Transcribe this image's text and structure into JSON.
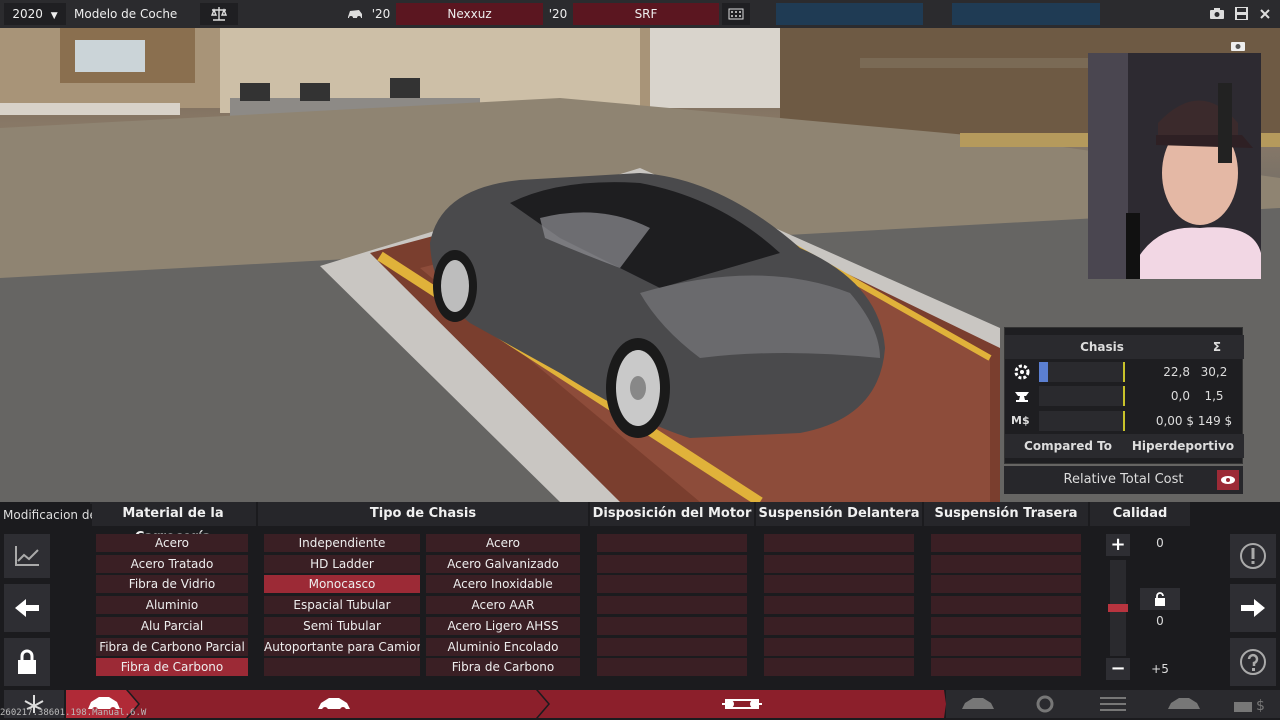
{
  "topbar": {
    "year": "2020",
    "model_label": "Modelo de Coche year",
    "model_year_prefix": "'20",
    "model_name": "Nexxuz",
    "trim_year_prefix": "'20",
    "trim_name": "SRF"
  },
  "stats": {
    "header_label": "Chasis",
    "sum_label": "Σ",
    "rows": [
      {
        "icon": "gear-wrench-icon",
        "value": "22,8",
        "total": "30,2",
        "bar": 0.1
      },
      {
        "icon": "anvil-icon",
        "value": "0,0",
        "total": "1,5",
        "bar": 0
      },
      {
        "icon": "money-icon",
        "icon_text": "M$",
        "value": "0,00 $",
        "total": "149 $",
        "bar": 0
      }
    ],
    "compared_to_label": "Compared To",
    "compared_to_value": "Hiperdeportivo",
    "relative_cost_label": "Relative Total Cost"
  },
  "bottom": {
    "tooltip_text": "Modificacion de",
    "headers": {
      "material": "Material de la Carrocería",
      "chassis": "Tipo de Chasis",
      "engine": "Disposición del Motor",
      "front": "Suspensión Delantera",
      "rear": "Suspensión Trasera",
      "quality": "Calidad"
    },
    "materials": [
      "Acero",
      "Acero Tratado",
      "Fibra de Vidrio",
      "Aluminio",
      "Alu Parcial",
      "Fibra de Carbono Parcial",
      "Fibra de Carbono"
    ],
    "chassis_types": [
      "Independiente",
      "HD Ladder",
      "Monocasco",
      "Espacial Tubular",
      "Semi Tubular",
      "Autoportante para Camioneta"
    ],
    "chassis_materials": [
      "Acero",
      "Acero Galvanizado",
      "Acero Inoxidable",
      "Acero AAR",
      "Acero Ligero AHSS",
      "Aluminio Encolado",
      "Fibra de Carbono"
    ],
    "quality": {
      "top": "0",
      "middle": "0",
      "bottom": "+5",
      "plus": "+",
      "minus": "−"
    }
  },
  "debug_text": "260217.38601.198.Manual.6.W"
}
